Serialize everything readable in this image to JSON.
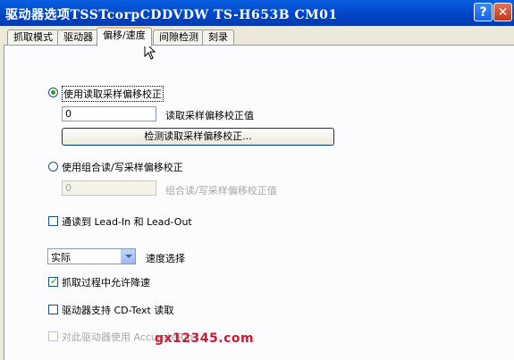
{
  "window": {
    "title": "驱动器选项TSSTcorpCDDVDW TS-H653B CM01",
    "help_label": "?",
    "close_label": "✕"
  },
  "tabs": [
    {
      "label": "抓取模式",
      "active": false
    },
    {
      "label": "驱动器",
      "active": false
    },
    {
      "label": "偏移/速度",
      "active": true
    },
    {
      "label": "间隙检测",
      "active": false
    },
    {
      "label": "刻录",
      "active": false
    }
  ],
  "offset": {
    "read_sample_radio_label": "使用读取采样偏移校正",
    "read_sample_radio_selected": true,
    "read_sample_value": "0",
    "read_sample_value_label": "读取采样偏移校正值",
    "detect_button_label": "检测读取采样偏移校正...",
    "combined_radio_label": "使用组合读/写采样偏移校正",
    "combined_radio_selected": false,
    "combined_value": "0",
    "combined_value_label": "组合读/写采样偏移校正值"
  },
  "options": {
    "lead_in_out_label": "通读到 Lead-In 和 Lead-Out",
    "lead_in_out_checked": false,
    "speed_value": "实际",
    "speed_label": "速度选择",
    "allow_slowdown_label": "抓取过程中允许降速",
    "allow_slowdown_checked": true,
    "cd_text_label": "驱动器支持 CD-Text 读取",
    "cd_text_checked": false,
    "accurate_label": "对此驱动器使用 AccurateRip",
    "accurate_checked": false
  },
  "watermark": "gx12345.com",
  "colors": {
    "titlebar": "#0046c8",
    "active_tab_accent": "#f7b85b",
    "check_green": "#21a121",
    "watermark": "#d0182e"
  }
}
